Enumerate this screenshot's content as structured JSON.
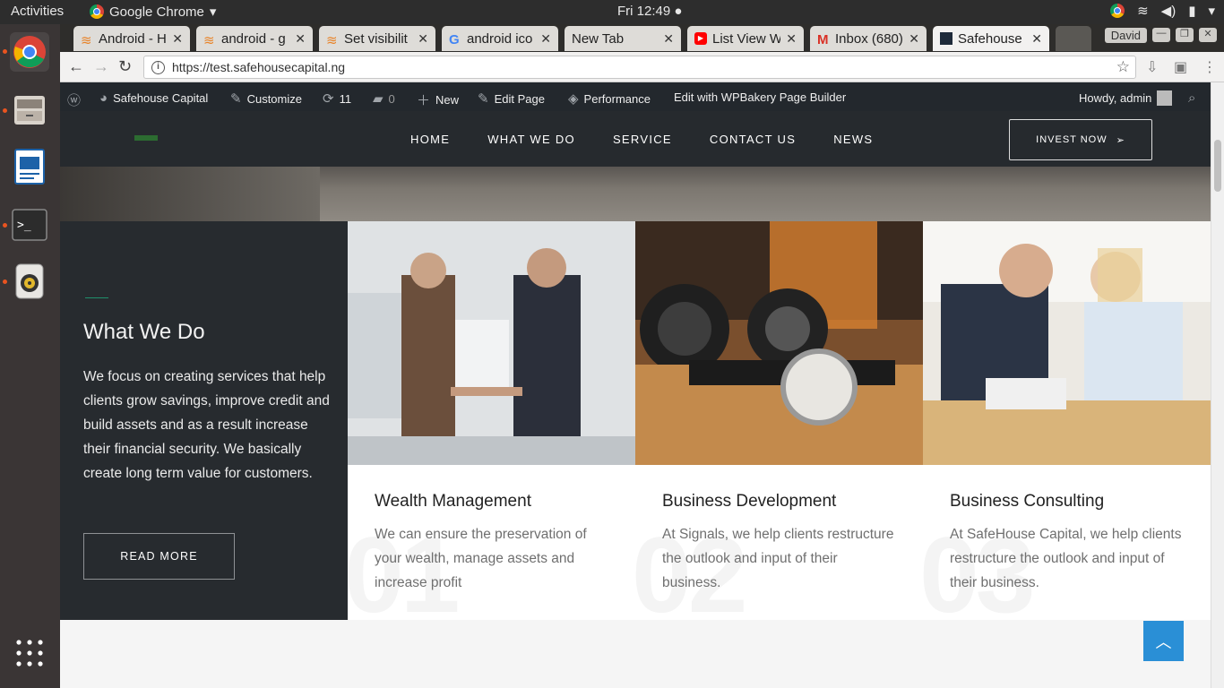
{
  "system": {
    "activities": "Activities",
    "app_name": "Google Chrome",
    "clock": "Fri 12:49 ●"
  },
  "tabs": [
    {
      "label": "Android - H",
      "favicon": "stackoverflow-icon"
    },
    {
      "label": "android - g",
      "favicon": "stackoverflow-icon"
    },
    {
      "label": "Set visibilit",
      "favicon": "stackoverflow-icon"
    },
    {
      "label": "android ico",
      "favicon": "google-icon"
    },
    {
      "label": "New Tab",
      "favicon": ""
    },
    {
      "label": "List View W",
      "favicon": "youtube-icon"
    },
    {
      "label": "Inbox (680)",
      "favicon": "gmail-icon"
    },
    {
      "label": "Safehouse",
      "favicon": "site-icon"
    }
  ],
  "window": {
    "user": "David"
  },
  "toolbar": {
    "url": "https://test.safehousecapital.ng"
  },
  "wpbar": {
    "site": "Safehouse Capital",
    "customize": "Customize",
    "updates": "11",
    "comments": "0",
    "new": "New",
    "edit_page": "Edit Page",
    "performance": "Performance",
    "wpbakery": "Edit with WPBakery Page Builder",
    "howdy": "Howdy, admin"
  },
  "nav": {
    "items": [
      "HOME",
      "WHAT WE DO",
      "SERVICE",
      "CONTACT US",
      "NEWS"
    ],
    "invest": "INVEST NOW"
  },
  "whatwedo": {
    "title": "What We Do",
    "text": "We focus on creating services that help clients grow savings, improve credit and build assets and as a result increase their financial security. We basically create long term value for customers.",
    "button": "READ MORE"
  },
  "services": [
    {
      "title": "Wealth Management",
      "text": "We can ensure the preservation of your wealth, manage assets and increase profit",
      "num": "01"
    },
    {
      "title": "Business Development",
      "text": "At Signals, we help clients restructure the outlook and input of their business.",
      "num": "02"
    },
    {
      "title": "Business Consulting",
      "text": "At SafeHouse Capital, we help clients restructure the outlook and input of their business.",
      "num": "03"
    }
  ],
  "colors": {
    "accent": "#2a8fd6",
    "dark_panel": "#272b2f",
    "wp_admin_bar": "#23282d"
  }
}
